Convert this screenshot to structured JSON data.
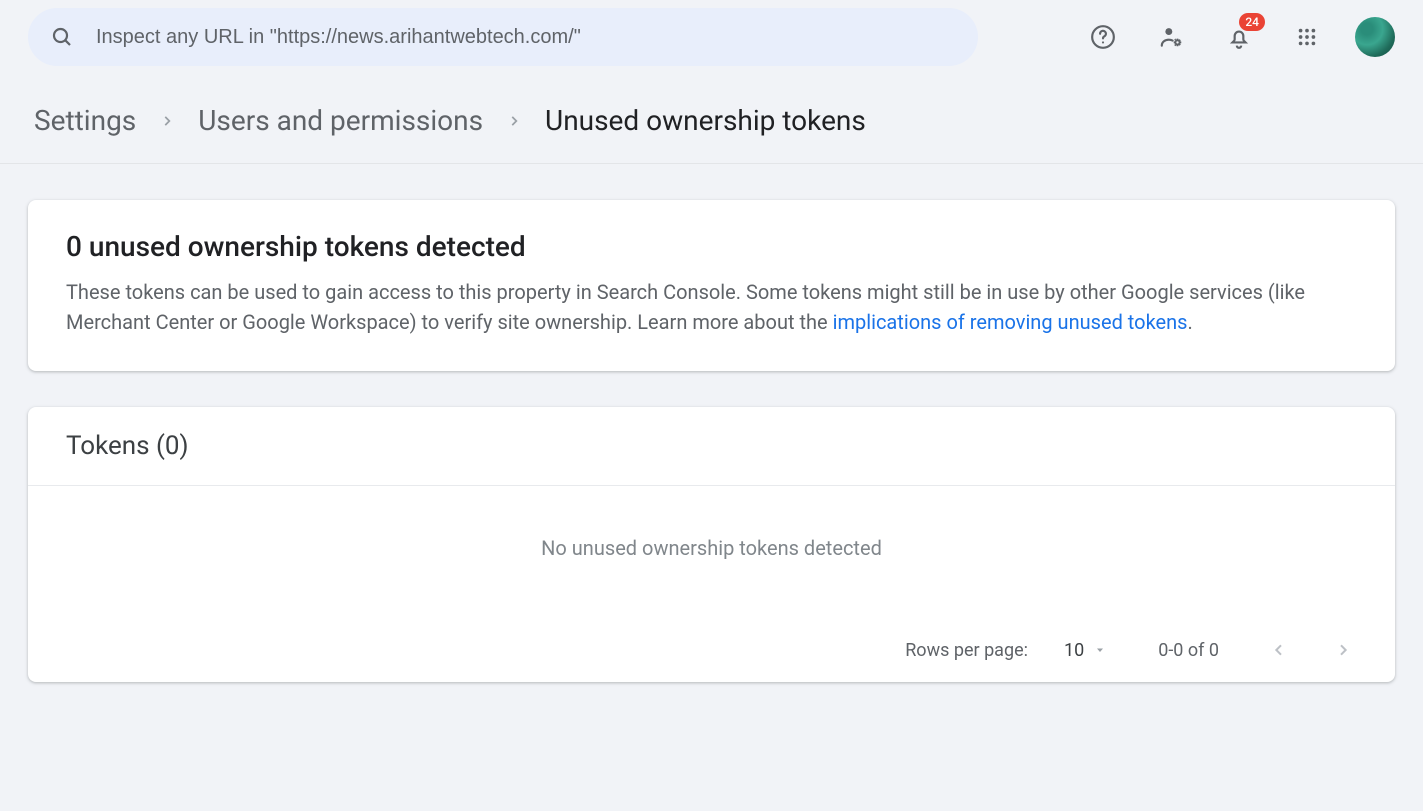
{
  "search": {
    "placeholder": "Inspect any URL in \"https://news.arihantwebtech.com/\""
  },
  "header": {
    "notification_count": "24"
  },
  "breadcrumb": {
    "items": [
      {
        "label": "Settings"
      },
      {
        "label": "Users and permissions"
      },
      {
        "label": "Unused ownership tokens"
      }
    ]
  },
  "summary": {
    "title": "0 unused ownership tokens detected",
    "body_pre": "These tokens can be used to gain access to this property in Search Console. Some tokens might still be in use by other Google services (like Merchant Center or Google Workspace) to verify site ownership. Learn more about the ",
    "link_text": "implications of removing unused tokens",
    "body_post": "."
  },
  "tokens": {
    "header": "Tokens (0)",
    "empty": "No unused ownership tokens detected"
  },
  "paginator": {
    "rows_label": "Rows per page:",
    "rows_value": "10",
    "range": "0-0 of 0"
  }
}
